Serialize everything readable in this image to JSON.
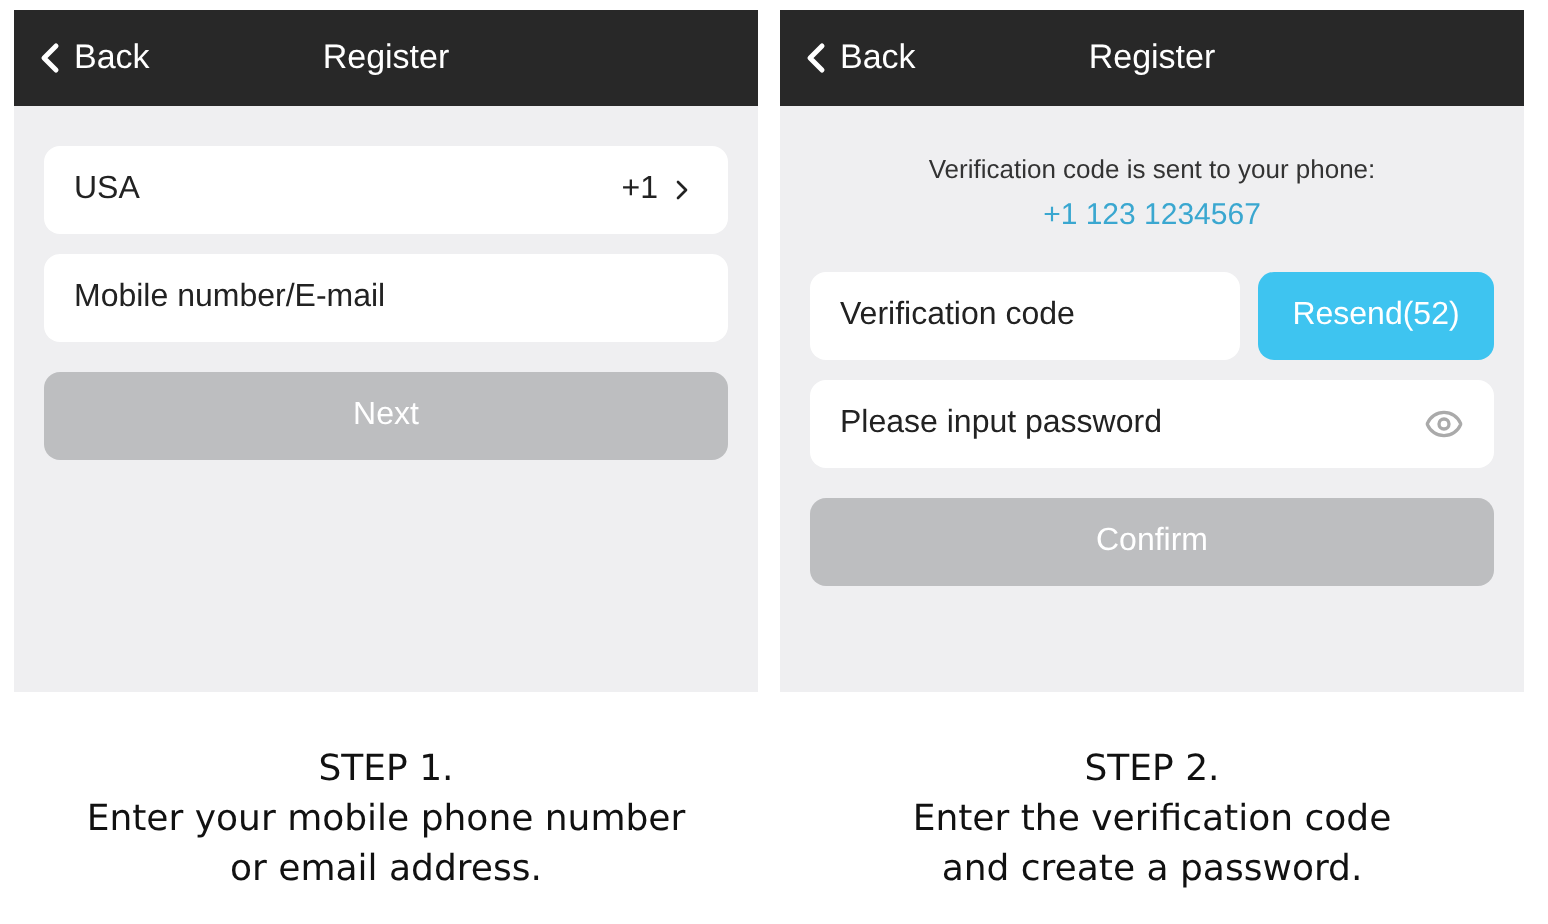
{
  "steps": [
    {
      "header": {
        "back": "Back",
        "title": "Register"
      },
      "rows": [
        {
          "kind": "select",
          "label": "USA",
          "value": "+1"
        },
        {
          "kind": "field",
          "placeholder": "Mobile number/E-mail"
        }
      ],
      "button": {
        "label": "Next",
        "disabled": true
      },
      "caption": {
        "step": "STEP 1.",
        "lines": [
          "Enter your mobile phone number",
          "or email address."
        ]
      }
    },
    {
      "header": {
        "back": "Back",
        "title": "Register"
      },
      "notice": {
        "text": "Verification code is sent to your phone:",
        "phone": "+1 123 1234567"
      },
      "rows": [
        {
          "kind": "code",
          "placeholder": "Verification code",
          "action": "Resend(52)"
        },
        {
          "kind": "password",
          "placeholder": "Please input password"
        }
      ],
      "button": {
        "label": "Confirm",
        "disabled": true
      },
      "caption": {
        "step": "STEP 2.",
        "lines": [
          "Enter the verification code",
          "and create a password."
        ]
      }
    }
  ]
}
